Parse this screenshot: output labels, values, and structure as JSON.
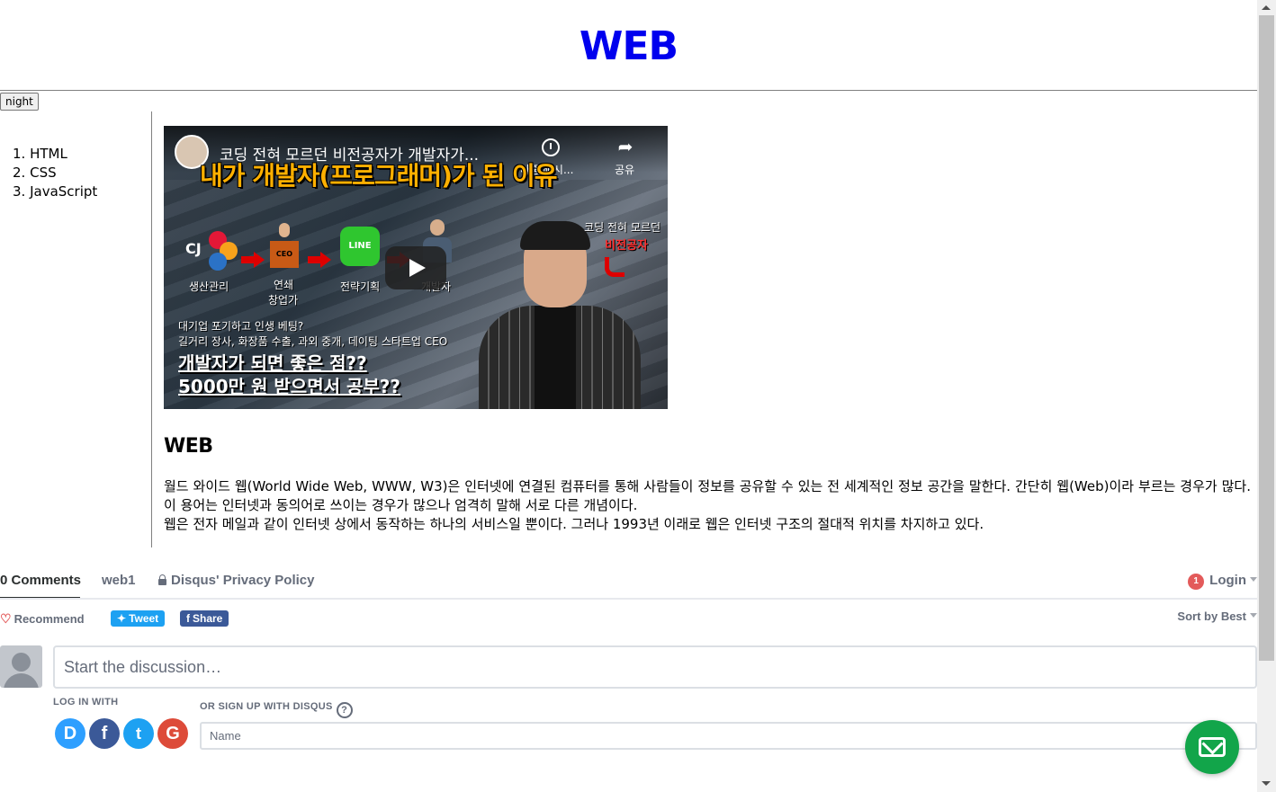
{
  "header": {
    "title": "WEB",
    "title_color": "#0000ee",
    "night_button_label": "night"
  },
  "nav": {
    "items": [
      {
        "number": "1.",
        "label": "HTML"
      },
      {
        "number": "2.",
        "label": "CSS"
      },
      {
        "number": "3.",
        "label": "JavaScript"
      }
    ]
  },
  "video": {
    "title": "코딩 전혀 모르던 비전공자가 개발자가...",
    "watch_later_label": "나중에 시...",
    "share_label": "공유",
    "headline": "내가 개발자(프로그래머)가 된 이유",
    "captions": {
      "cj": "생산관리",
      "ceo_top": "연쇄",
      "ceo_bottom": "창업가",
      "line": "전략기획",
      "dev": "개발자",
      "ceo_box": "CEO",
      "line_logo": "LINE",
      "cj_logo": "CJ"
    },
    "tag_top": "코딩 전혀 모르던",
    "tag_bottom": "비전공자",
    "desc_lines": [
      "대기업 포기하고 인생 베팅?",
      "길거리 장사, 화장품 수출, 과외 중개, 데이팅 스타트업 CEO"
    ],
    "desc_big": [
      "개발자가 되면 좋은 점??",
      "5000만 원 받으면서 공부??"
    ]
  },
  "article": {
    "heading": "WEB",
    "paragraph_1": "월드 와이드 웹(World Wide Web, WWW, W3)은 인터넷에 연결된 컴퓨터를 통해 사람들이 정보를 공유할 수 있는 전 세계적인 정보 공간을 말한다. 간단히 웹(Web)이라 부르는 경우가 많다. 이 용어는 인터넷과 동의어로 쓰이는 경우가 많으나 엄격히 말해 서로 다른 개념이다.",
    "paragraph_2": "웹은 전자 메일과 같이 인터넷 상에서 동작하는 하나의 서비스일 뿐이다. 그러나 1993년 이래로 웹은 인터넷 구조의 절대적 위치를 차지하고 있다."
  },
  "disqus": {
    "comments_tab": "0 Comments",
    "community_tab": "web1",
    "privacy_tab": "Disqus' Privacy Policy",
    "notification_count": "1",
    "login_label": "Login",
    "recommend_label": "Recommend",
    "tweet_label": "Tweet",
    "share_label": "Share",
    "sort_label": "Sort by Best",
    "discussion_placeholder": "Start the discussion…",
    "login_with_label": "LOG IN WITH",
    "signup_label": "OR SIGN UP WITH DISQUS",
    "name_placeholder": "Name",
    "social": {
      "disqus": "D",
      "facebook": "f",
      "twitter": "t",
      "google": "G"
    },
    "colors": {
      "disqus": "#2e9fff",
      "facebook": "#3b5998",
      "twitter": "#1da1f2",
      "google": "#dd4b39",
      "fab": "#12a54a"
    }
  }
}
